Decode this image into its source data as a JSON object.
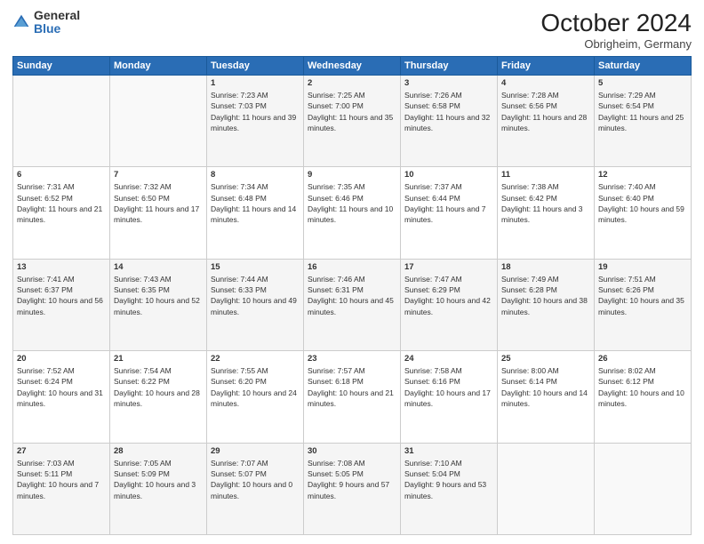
{
  "logo": {
    "general": "General",
    "blue": "Blue"
  },
  "header": {
    "month_year": "October 2024",
    "location": "Obrigheim, Germany"
  },
  "weekdays": [
    "Sunday",
    "Monday",
    "Tuesday",
    "Wednesday",
    "Thursday",
    "Friday",
    "Saturday"
  ],
  "rows": [
    [
      {
        "day": "",
        "sunrise": "",
        "sunset": "",
        "daylight": ""
      },
      {
        "day": "",
        "sunrise": "",
        "sunset": "",
        "daylight": ""
      },
      {
        "day": "1",
        "sunrise": "Sunrise: 7:23 AM",
        "sunset": "Sunset: 7:03 PM",
        "daylight": "Daylight: 11 hours and 39 minutes."
      },
      {
        "day": "2",
        "sunrise": "Sunrise: 7:25 AM",
        "sunset": "Sunset: 7:00 PM",
        "daylight": "Daylight: 11 hours and 35 minutes."
      },
      {
        "day": "3",
        "sunrise": "Sunrise: 7:26 AM",
        "sunset": "Sunset: 6:58 PM",
        "daylight": "Daylight: 11 hours and 32 minutes."
      },
      {
        "day": "4",
        "sunrise": "Sunrise: 7:28 AM",
        "sunset": "Sunset: 6:56 PM",
        "daylight": "Daylight: 11 hours and 28 minutes."
      },
      {
        "day": "5",
        "sunrise": "Sunrise: 7:29 AM",
        "sunset": "Sunset: 6:54 PM",
        "daylight": "Daylight: 11 hours and 25 minutes."
      }
    ],
    [
      {
        "day": "6",
        "sunrise": "Sunrise: 7:31 AM",
        "sunset": "Sunset: 6:52 PM",
        "daylight": "Daylight: 11 hours and 21 minutes."
      },
      {
        "day": "7",
        "sunrise": "Sunrise: 7:32 AM",
        "sunset": "Sunset: 6:50 PM",
        "daylight": "Daylight: 11 hours and 17 minutes."
      },
      {
        "day": "8",
        "sunrise": "Sunrise: 7:34 AM",
        "sunset": "Sunset: 6:48 PM",
        "daylight": "Daylight: 11 hours and 14 minutes."
      },
      {
        "day": "9",
        "sunrise": "Sunrise: 7:35 AM",
        "sunset": "Sunset: 6:46 PM",
        "daylight": "Daylight: 11 hours and 10 minutes."
      },
      {
        "day": "10",
        "sunrise": "Sunrise: 7:37 AM",
        "sunset": "Sunset: 6:44 PM",
        "daylight": "Daylight: 11 hours and 7 minutes."
      },
      {
        "day": "11",
        "sunrise": "Sunrise: 7:38 AM",
        "sunset": "Sunset: 6:42 PM",
        "daylight": "Daylight: 11 hours and 3 minutes."
      },
      {
        "day": "12",
        "sunrise": "Sunrise: 7:40 AM",
        "sunset": "Sunset: 6:40 PM",
        "daylight": "Daylight: 10 hours and 59 minutes."
      }
    ],
    [
      {
        "day": "13",
        "sunrise": "Sunrise: 7:41 AM",
        "sunset": "Sunset: 6:37 PM",
        "daylight": "Daylight: 10 hours and 56 minutes."
      },
      {
        "day": "14",
        "sunrise": "Sunrise: 7:43 AM",
        "sunset": "Sunset: 6:35 PM",
        "daylight": "Daylight: 10 hours and 52 minutes."
      },
      {
        "day": "15",
        "sunrise": "Sunrise: 7:44 AM",
        "sunset": "Sunset: 6:33 PM",
        "daylight": "Daylight: 10 hours and 49 minutes."
      },
      {
        "day": "16",
        "sunrise": "Sunrise: 7:46 AM",
        "sunset": "Sunset: 6:31 PM",
        "daylight": "Daylight: 10 hours and 45 minutes."
      },
      {
        "day": "17",
        "sunrise": "Sunrise: 7:47 AM",
        "sunset": "Sunset: 6:29 PM",
        "daylight": "Daylight: 10 hours and 42 minutes."
      },
      {
        "day": "18",
        "sunrise": "Sunrise: 7:49 AM",
        "sunset": "Sunset: 6:28 PM",
        "daylight": "Daylight: 10 hours and 38 minutes."
      },
      {
        "day": "19",
        "sunrise": "Sunrise: 7:51 AM",
        "sunset": "Sunset: 6:26 PM",
        "daylight": "Daylight: 10 hours and 35 minutes."
      }
    ],
    [
      {
        "day": "20",
        "sunrise": "Sunrise: 7:52 AM",
        "sunset": "Sunset: 6:24 PM",
        "daylight": "Daylight: 10 hours and 31 minutes."
      },
      {
        "day": "21",
        "sunrise": "Sunrise: 7:54 AM",
        "sunset": "Sunset: 6:22 PM",
        "daylight": "Daylight: 10 hours and 28 minutes."
      },
      {
        "day": "22",
        "sunrise": "Sunrise: 7:55 AM",
        "sunset": "Sunset: 6:20 PM",
        "daylight": "Daylight: 10 hours and 24 minutes."
      },
      {
        "day": "23",
        "sunrise": "Sunrise: 7:57 AM",
        "sunset": "Sunset: 6:18 PM",
        "daylight": "Daylight: 10 hours and 21 minutes."
      },
      {
        "day": "24",
        "sunrise": "Sunrise: 7:58 AM",
        "sunset": "Sunset: 6:16 PM",
        "daylight": "Daylight: 10 hours and 17 minutes."
      },
      {
        "day": "25",
        "sunrise": "Sunrise: 8:00 AM",
        "sunset": "Sunset: 6:14 PM",
        "daylight": "Daylight: 10 hours and 14 minutes."
      },
      {
        "day": "26",
        "sunrise": "Sunrise: 8:02 AM",
        "sunset": "Sunset: 6:12 PM",
        "daylight": "Daylight: 10 hours and 10 minutes."
      }
    ],
    [
      {
        "day": "27",
        "sunrise": "Sunrise: 7:03 AM",
        "sunset": "Sunset: 5:11 PM",
        "daylight": "Daylight: 10 hours and 7 minutes."
      },
      {
        "day": "28",
        "sunrise": "Sunrise: 7:05 AM",
        "sunset": "Sunset: 5:09 PM",
        "daylight": "Daylight: 10 hours and 3 minutes."
      },
      {
        "day": "29",
        "sunrise": "Sunrise: 7:07 AM",
        "sunset": "Sunset: 5:07 PM",
        "daylight": "Daylight: 10 hours and 0 minutes."
      },
      {
        "day": "30",
        "sunrise": "Sunrise: 7:08 AM",
        "sunset": "Sunset: 5:05 PM",
        "daylight": "Daylight: 9 hours and 57 minutes."
      },
      {
        "day": "31",
        "sunrise": "Sunrise: 7:10 AM",
        "sunset": "Sunset: 5:04 PM",
        "daylight": "Daylight: 9 hours and 53 minutes."
      },
      {
        "day": "",
        "sunrise": "",
        "sunset": "",
        "daylight": ""
      },
      {
        "day": "",
        "sunrise": "",
        "sunset": "",
        "daylight": ""
      }
    ]
  ]
}
